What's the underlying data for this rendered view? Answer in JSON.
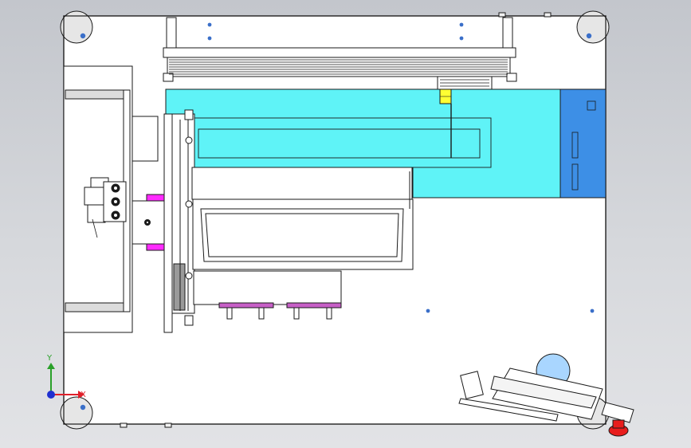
{
  "triad": {
    "x_label": "X",
    "y_label": "Y",
    "x_color": "#e0202a",
    "y_color": "#2aa02a",
    "z_color": "#2030d0"
  },
  "colors": {
    "background_top": "#c3c6cc",
    "background_bottom": "#e2e3e6",
    "plate": "#ffffff",
    "outline": "#1a1a1a",
    "cyan_region": "#5ff3f7",
    "blue_block": "#3d8fe6",
    "magenta_part": "#ff2bff",
    "yellow_part": "#ffff33",
    "light_blue_disc": "#a9d6ff",
    "red_button": "#e81d1d",
    "mounting_hole": "#3a6fc9",
    "corner_foot": "#e6e6e6"
  }
}
